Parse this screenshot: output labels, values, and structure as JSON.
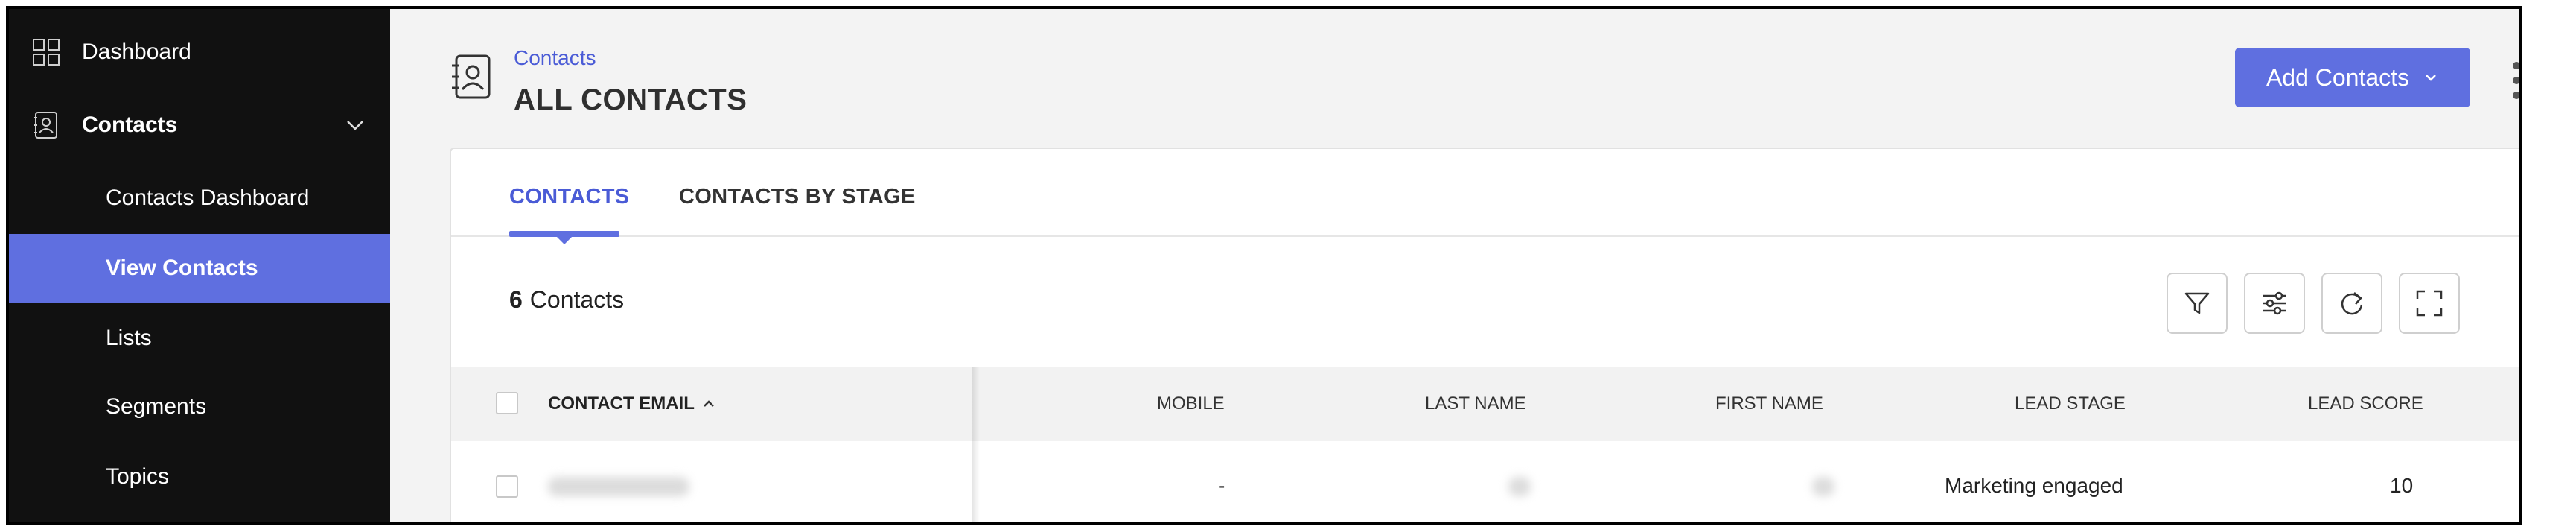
{
  "sidebar": {
    "dashboard_label": "Dashboard",
    "contacts_label": "Contacts",
    "sub_items": [
      {
        "label": "Contacts Dashboard"
      },
      {
        "label": "View Contacts"
      },
      {
        "label": "Lists"
      },
      {
        "label": "Segments"
      },
      {
        "label": "Topics"
      }
    ]
  },
  "header": {
    "breadcrumb": "Contacts",
    "title": "ALL CONTACTS",
    "add_button_label": "Add Contacts"
  },
  "tabs": [
    {
      "label": "CONTACTS"
    },
    {
      "label": "CONTACTS BY STAGE"
    }
  ],
  "summary": {
    "count": "6",
    "label": "Contacts"
  },
  "table": {
    "columns": [
      {
        "label": "CONTACT EMAIL"
      },
      {
        "label": "MOBILE"
      },
      {
        "label": "LAST NAME"
      },
      {
        "label": "FIRST NAME"
      },
      {
        "label": "LEAD STAGE"
      },
      {
        "label": "LEAD SCORE"
      }
    ],
    "rows": [
      {
        "mobile": "-",
        "lead_stage": "Marketing engaged",
        "lead_score": "10"
      }
    ]
  },
  "colors": {
    "accent": "#5f6fe0",
    "sidebar_bg": "#111111",
    "annotation": "#d9231e"
  }
}
